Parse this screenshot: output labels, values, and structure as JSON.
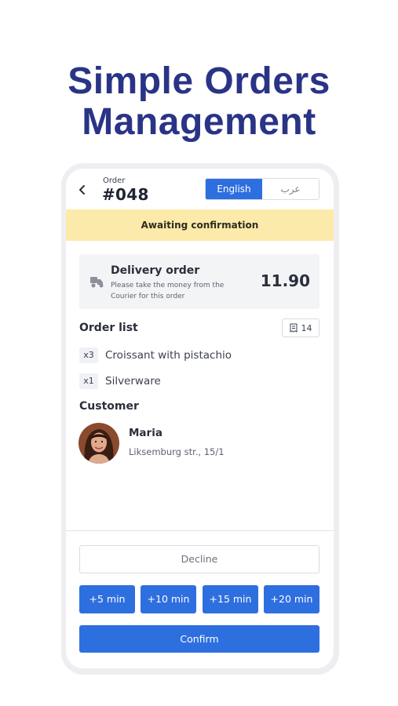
{
  "promo": {
    "headline_line1": "Simple Orders",
    "headline_line2": "Management"
  },
  "header": {
    "back_icon": "chevron-left-icon",
    "order_caption": "Order",
    "order_number": "#048",
    "languages": [
      {
        "label": "English",
        "selected": true
      },
      {
        "label": "عرب",
        "selected": false
      }
    ]
  },
  "status": {
    "text": "Awaiting confirmation",
    "color": "#fbeaa9"
  },
  "delivery": {
    "icon": "courier-scooter-icon",
    "title": "Delivery order",
    "note": "Please take the money from the Courier for this order",
    "amount": "11.90"
  },
  "order_list": {
    "title": "Order list",
    "receipt_icon": "receipt-icon",
    "receipt_count": "14",
    "items": [
      {
        "qty": "x3",
        "name": "Croissant with pistachio"
      },
      {
        "qty": "x1",
        "name": "Silverware"
      }
    ]
  },
  "customer": {
    "title": "Customer",
    "name": "Maria",
    "address": "Liksemburg str., 15/1"
  },
  "actions": {
    "decline": "Decline",
    "time_options": [
      "+5 min",
      "+10 min",
      "+15 min",
      "+20 min"
    ],
    "confirm": "Confirm"
  },
  "colors": {
    "accent": "#2e6fe0",
    "headline": "#2a3486"
  }
}
